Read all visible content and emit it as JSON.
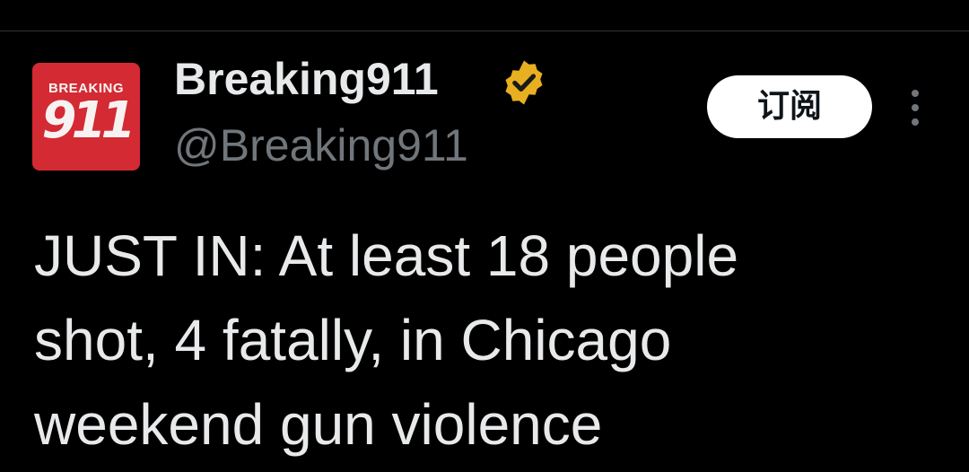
{
  "tweet": {
    "avatar": {
      "logo_top_text": "BREAKING",
      "logo_number": "911",
      "background_color": "#d42a33"
    },
    "author": {
      "display_name": "Breaking911",
      "handle": "@Breaking911",
      "verified_badge": {
        "icon": "verified-badge-icon",
        "color": "#e8b020"
      }
    },
    "subscribe_label": "订阅",
    "more_icon": "more-vertical-icon",
    "text_lines": [
      "JUST IN: At least 18 people",
      "shot, 4 fatally, in Chicago",
      "weekend gun violence"
    ]
  },
  "colors": {
    "background": "#000000",
    "primary_text": "#e7e9ea",
    "secondary_text": "#71767b",
    "button_bg": "#ffffff",
    "button_text": "#0f1419"
  }
}
